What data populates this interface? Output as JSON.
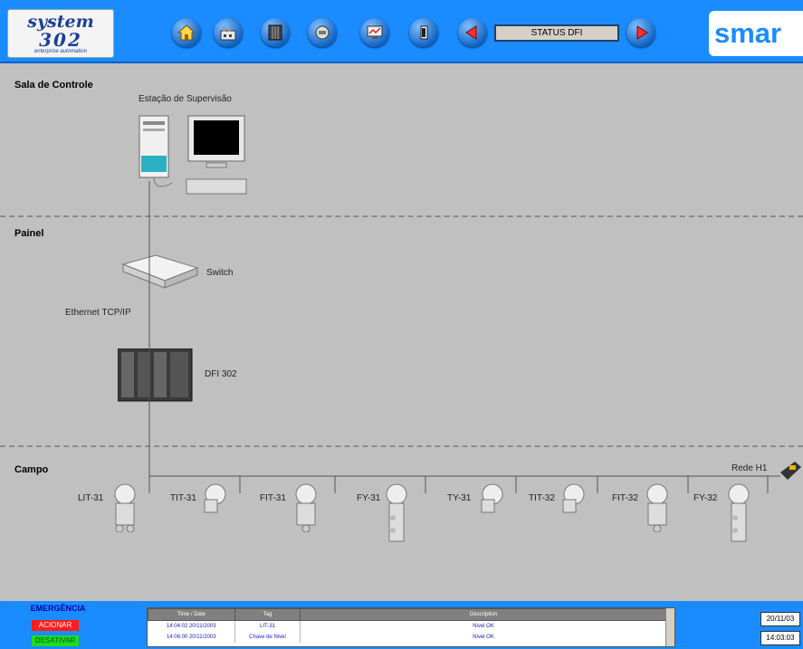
{
  "header": {
    "logo_top": "system",
    "logo_mid": "302",
    "logo_sub": "enterprise automation",
    "status_label": "STATUS DFI",
    "brand": "smar"
  },
  "nav_icons": [
    "home-icon",
    "factory-icon",
    "cabinet-icon",
    "tools-icon",
    "monitor-icon",
    "exit-icon",
    "prev-arrow-icon",
    "next-arrow-icon"
  ],
  "zones": {
    "control_room": "Sala de Controle",
    "panel": "Painel",
    "field": "Campo"
  },
  "devices": {
    "supervision": "Estação de Supervisão",
    "switch": "Switch",
    "ethernet": "Ethernet TCP/IP",
    "dfi": "DFI 302",
    "network": "Rede H1"
  },
  "field_devices": [
    {
      "tag": "LIT-31"
    },
    {
      "tag": "TIT-31"
    },
    {
      "tag": "FIT-31"
    },
    {
      "tag": "FY-31"
    },
    {
      "tag": "TY-31"
    },
    {
      "tag": "TIT-32"
    },
    {
      "tag": "FIT-32"
    },
    {
      "tag": "FY-32"
    }
  ],
  "emergency": {
    "title": "EMERGÊNCIA",
    "on_label": "ACIONAR",
    "off_label": "DESATIVAR"
  },
  "alarm_table": {
    "headers": [
      "Time / Date",
      "Tag",
      "Description"
    ],
    "rows": [
      [
        "14:04:02  20/11/2003",
        "LIT-31",
        "Nivel OK"
      ],
      [
        "14:06:00  20/11/2003",
        "Chave de Nivel",
        "Nivel OK"
      ]
    ]
  },
  "datetime": {
    "date": "20/11/03",
    "time": "14:03:03"
  },
  "colors": {
    "bar": "#1a8cff",
    "background": "#c0c0c0",
    "alarm_text": "#2020c0"
  }
}
